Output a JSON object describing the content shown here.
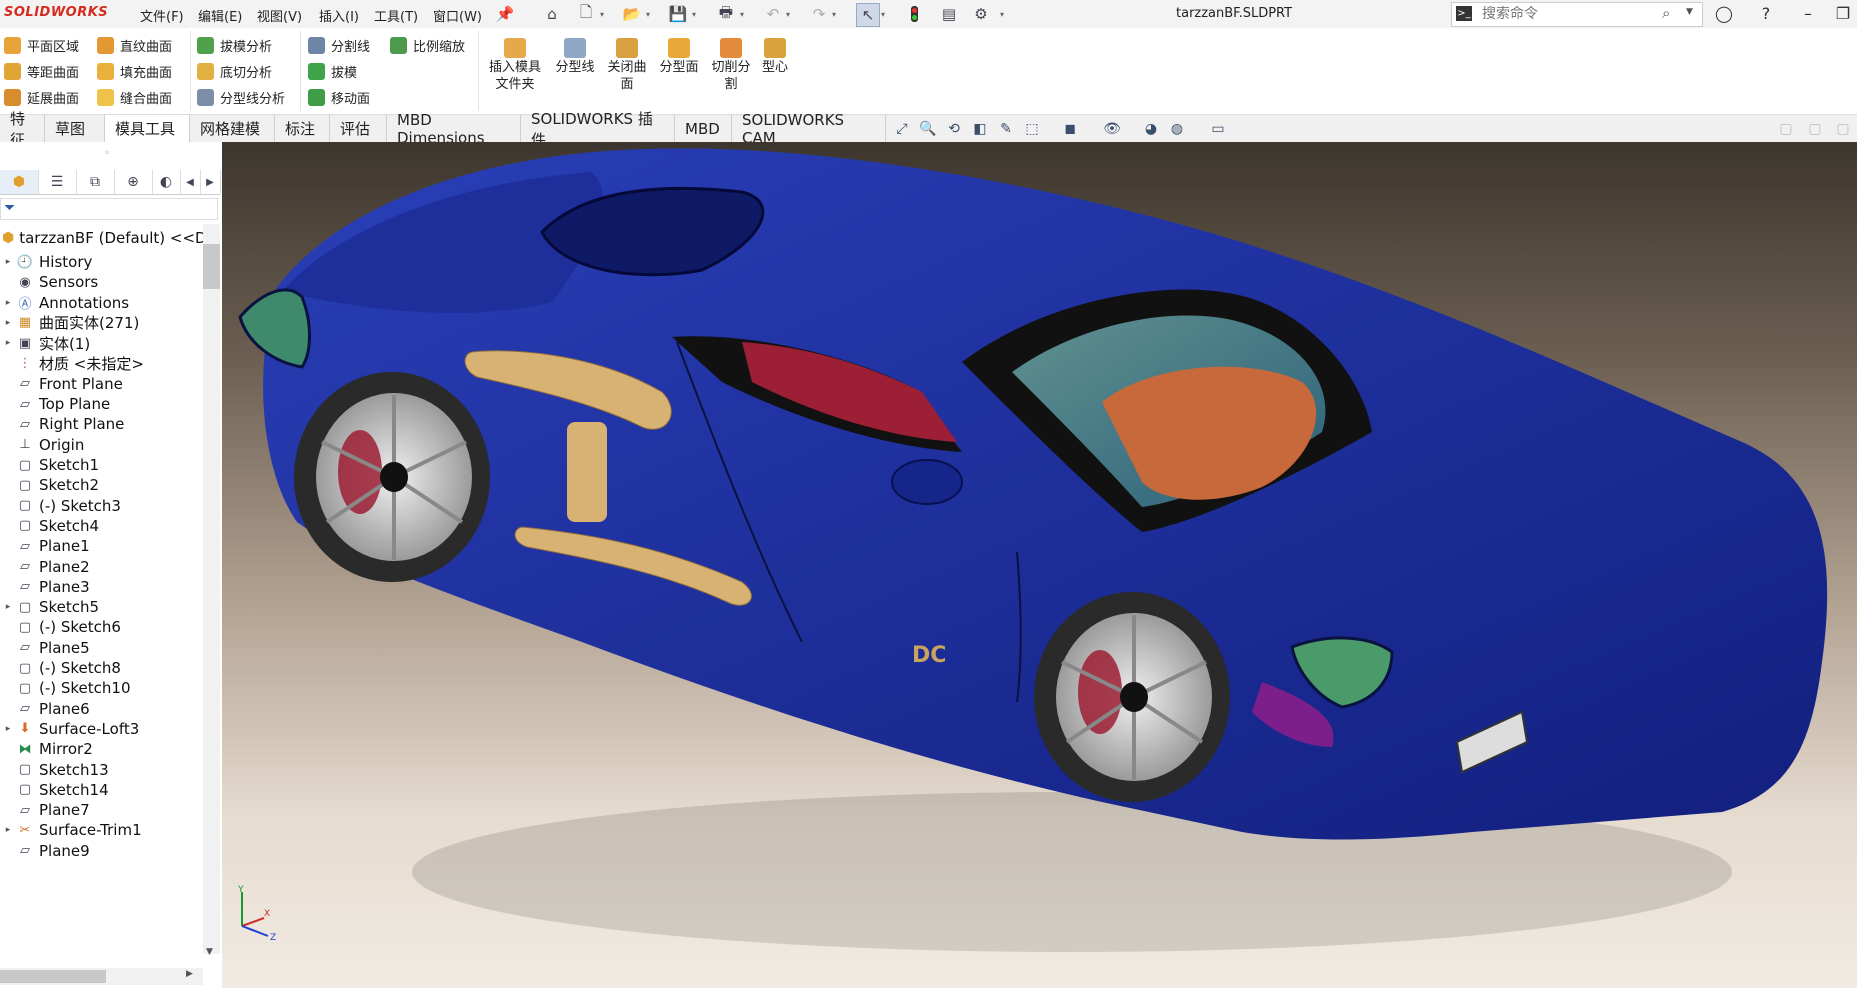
{
  "app": {
    "logo": "SOLIDWORKS",
    "document_title": "tarzzanBF.SLDPRT"
  },
  "menu": [
    "文件(F)",
    "编辑(E)",
    "视图(V)",
    "插入(I)",
    "工具(T)",
    "窗口(W)"
  ],
  "search": {
    "placeholder": "搜索命令"
  },
  "commands": {
    "col1": [
      "平面区域",
      "等距曲面",
      "延展曲面"
    ],
    "col2": [
      "直纹曲面",
      "填充曲面",
      "缝合曲面"
    ],
    "col3": [
      "拔模分析",
      "底切分析",
      "分型线分析"
    ],
    "col4": [
      "分割线",
      "拔模",
      "移动面"
    ],
    "col5": [
      "比例缩放"
    ],
    "big": [
      {
        "line1": "插入模具",
        "line2": "文件夹"
      },
      {
        "line1": "分型线",
        "line2": ""
      },
      {
        "line1": "关闭曲",
        "line2": "面"
      },
      {
        "line1": "分型面",
        "line2": ""
      },
      {
        "line1": "切削分",
        "line2": "割"
      },
      {
        "line1": "型心",
        "line2": ""
      }
    ]
  },
  "tabs": [
    "特征",
    "草图",
    "模具工具",
    "网格建模",
    "标注",
    "评估",
    "MBD Dimensions",
    "SOLIDWORKS 插件",
    "MBD",
    "SOLIDWORKS CAM"
  ],
  "active_tab": "模具工具",
  "tree": {
    "root": "tarzzanBF (Default) <<De",
    "items": [
      {
        "label": "History",
        "icon": "history-icon",
        "expander": true
      },
      {
        "label": "Sensors",
        "icon": "sensors-icon",
        "expander": false
      },
      {
        "label": "Annotations",
        "icon": "annotations-icon",
        "expander": true
      },
      {
        "label": "曲面实体(271)",
        "icon": "surface-bodies-icon",
        "expander": true
      },
      {
        "label": "实体(1)",
        "icon": "solid-bodies-icon",
        "expander": true
      },
      {
        "label": "材质 <未指定>",
        "icon": "material-icon",
        "expander": false
      },
      {
        "label": "Front Plane",
        "icon": "plane-icon",
        "expander": false
      },
      {
        "label": "Top Plane",
        "icon": "plane-icon",
        "expander": false
      },
      {
        "label": "Right Plane",
        "icon": "plane-icon",
        "expander": false
      },
      {
        "label": "Origin",
        "icon": "origin-icon",
        "expander": false
      },
      {
        "label": "Sketch1",
        "icon": "sketch-icon",
        "expander": false
      },
      {
        "label": "Sketch2",
        "icon": "sketch-icon",
        "expander": false
      },
      {
        "label": "(-) Sketch3",
        "icon": "sketch-icon",
        "expander": false
      },
      {
        "label": "Sketch4",
        "icon": "sketch-icon",
        "expander": false
      },
      {
        "label": "Plane1",
        "icon": "plane-icon",
        "expander": false
      },
      {
        "label": "Plane2",
        "icon": "plane-icon",
        "expander": false
      },
      {
        "label": "Plane3",
        "icon": "plane-icon",
        "expander": false
      },
      {
        "label": "Sketch5",
        "icon": "sketch-icon",
        "expander": true
      },
      {
        "label": "(-) Sketch6",
        "icon": "sketch-icon",
        "expander": false
      },
      {
        "label": "Plane5",
        "icon": "plane-icon",
        "expander": false
      },
      {
        "label": "(-) Sketch8",
        "icon": "sketch-icon",
        "expander": false
      },
      {
        "label": "(-) Sketch10",
        "icon": "sketch-icon",
        "expander": false
      },
      {
        "label": "Plane6",
        "icon": "plane-icon",
        "expander": false
      },
      {
        "label": "Surface-Loft3",
        "icon": "loft-icon",
        "expander": true
      },
      {
        "label": "Mirror2",
        "icon": "mirror-icon",
        "expander": false
      },
      {
        "label": "Sketch13",
        "icon": "sketch-icon",
        "expander": false
      },
      {
        "label": "Sketch14",
        "icon": "sketch-icon",
        "expander": false
      },
      {
        "label": "Plane7",
        "icon": "plane-icon",
        "expander": false
      },
      {
        "label": "Surface-Trim1",
        "icon": "trim-icon",
        "expander": true
      },
      {
        "label": "Plane9",
        "icon": "plane-icon",
        "expander": false
      }
    ]
  },
  "triad": {
    "x": "X",
    "y": "Y",
    "z": "Z"
  },
  "badge": "DC",
  "colors": {
    "body": "#1b2c9a",
    "seat": "#c8693c",
    "interior": "#a32237",
    "rim": "#c9c9c9",
    "tire": "#2a2a2a",
    "accent_tan": "#d8b273"
  }
}
